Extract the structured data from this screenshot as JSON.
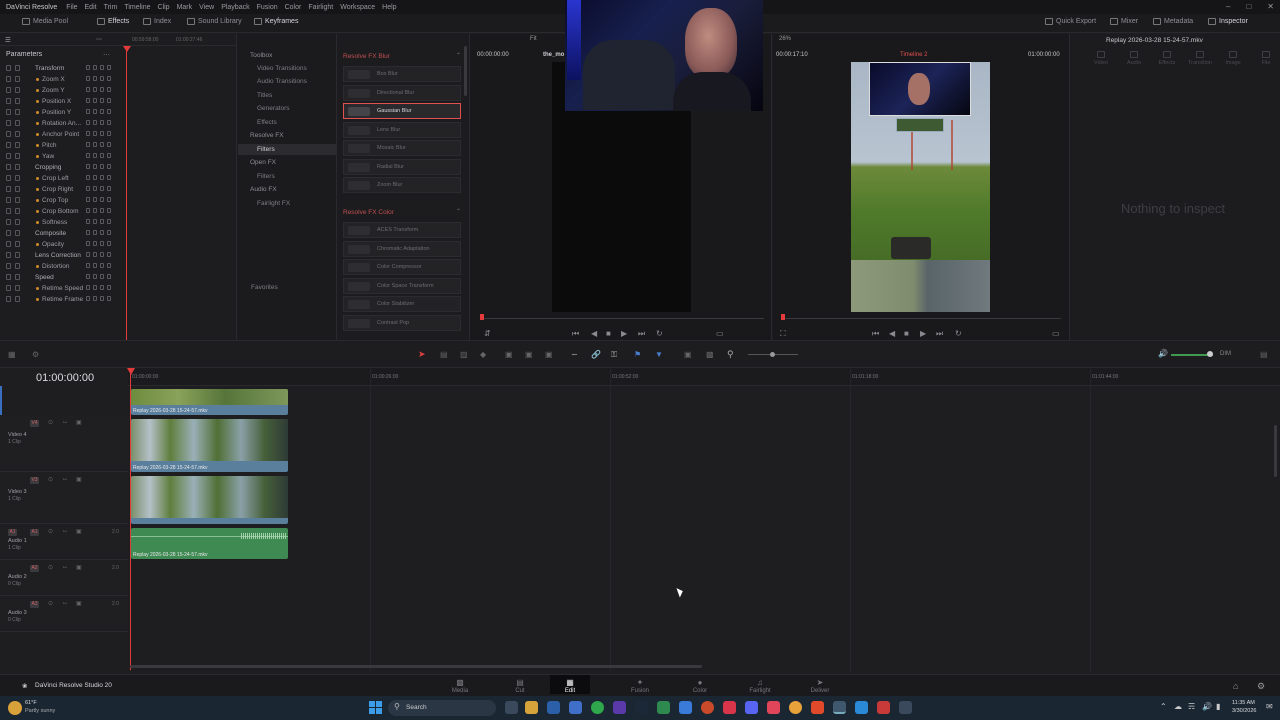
{
  "menu": {
    "app": "DaVinci Resolve",
    "items": [
      "File",
      "Edit",
      "Trim",
      "Timeline",
      "Clip",
      "Mark",
      "View",
      "Playback",
      "Fusion",
      "Color",
      "Fairlight",
      "Workspace",
      "Help"
    ]
  },
  "toolbar": {
    "media_pool": "Media Pool",
    "effects": "Effects",
    "index": "Index",
    "sound_library": "Sound Library",
    "keyframes": "Keyframes",
    "quick_export": "Quick Export",
    "mixer": "Mixer",
    "metadata": "Metadata",
    "inspector": "Inspector"
  },
  "parameters": {
    "title": "Parameters",
    "rows": [
      {
        "label": "Transform",
        "group": true
      },
      {
        "label": "Zoom X",
        "group": false
      },
      {
        "label": "Zoom Y",
        "group": false
      },
      {
        "label": "Position X",
        "group": false
      },
      {
        "label": "Position Y",
        "group": false
      },
      {
        "label": "Rotation An...",
        "group": false
      },
      {
        "label": "Anchor Point",
        "group": false
      },
      {
        "label": "Pitch",
        "group": false
      },
      {
        "label": "Yaw",
        "group": false
      },
      {
        "label": "Cropping",
        "group": true
      },
      {
        "label": "Crop Left",
        "group": false
      },
      {
        "label": "Crop Right",
        "group": false
      },
      {
        "label": "Crop Top",
        "group": false
      },
      {
        "label": "Crop Bottom",
        "group": false
      },
      {
        "label": "Softness",
        "group": false
      },
      {
        "label": "Composite",
        "group": true
      },
      {
        "label": "Opacity",
        "group": false
      },
      {
        "label": "Lens Correction",
        "group": true
      },
      {
        "label": "Distortion",
        "group": false
      },
      {
        "label": "Speed",
        "group": true
      },
      {
        "label": "Retime Speed",
        "group": false
      },
      {
        "label": "Retime Frame",
        "group": false
      }
    ],
    "ruler": [
      "00:59:58:00",
      "01:00:27:46"
    ]
  },
  "library": {
    "toolbox": "Toolbox",
    "video_transitions": "Video Transitions",
    "audio_transitions": "Audio Transitions",
    "titles": "Titles",
    "generators": "Generators",
    "effects": "Effects",
    "resolve_fx": "Resolve FX",
    "filters": "Filters",
    "open_fx": "Open FX",
    "open_filters": "Filters",
    "audio_fx": "Audio FX",
    "fairlight_fx": "Fairlight FX",
    "favorites": "Favorites"
  },
  "fx": {
    "blur_header": "Resolve FX Blur",
    "blur_items": [
      "Box Blur",
      "Directional Blur",
      "Gaussian Blur",
      "Lens Blur",
      "Mosaic Blur",
      "Radial Blur",
      "Zoom Blur"
    ],
    "selected": "Gaussian Blur",
    "color_header": "Resolve FX Color",
    "color_items": [
      "ACES Transform",
      "Chromatic Adaptation",
      "Color Compressor",
      "Color Space Transform",
      "Color Stabilizer",
      "Contrast Pop"
    ]
  },
  "source_viewer": {
    "zoom": "Fit",
    "timecode": "00:00:00:00",
    "clip_name": "the_mo"
  },
  "timeline_viewer": {
    "zoom": "26%",
    "duration": "00:00:17:10",
    "name": "Timeline 2",
    "timecode": "01:00:00:00"
  },
  "inspector": {
    "title": "Replay 2026-03-28 15-24-57.mkv",
    "tabs": [
      "Video",
      "Audio",
      "Effects",
      "Transition",
      "Image",
      "File"
    ],
    "empty": "Nothing to inspect"
  },
  "timeline": {
    "timecode": "01:00:00:00",
    "ruler": [
      "01:00:00:00",
      "01:00:26:00",
      "01:00:52:00",
      "01:01:18:00",
      "01:01:44:00"
    ],
    "tracks": [
      {
        "id": "V4",
        "name": "Video 4",
        "clips": "1 Clip"
      },
      {
        "id": "V3",
        "name": "Video 3",
        "clips": "1 Clip"
      },
      {
        "id": "A1",
        "name": "Audio 1",
        "clips": "1 Clip",
        "level": "2.0"
      },
      {
        "id": "A2",
        "name": "Audio 2",
        "clips": "0 Clip",
        "level": "2.0"
      },
      {
        "id": "A3",
        "name": "Audio 3",
        "clips": "0 Clip",
        "level": "2.0"
      }
    ],
    "clip_name": "Replay 2026-03-28 15-24-57.mkv",
    "dim": "DIM"
  },
  "pages": [
    "Media",
    "Cut",
    "Edit",
    "Fusion",
    "Color",
    "Fairlight",
    "Deliver"
  ],
  "active_page": "Edit",
  "brand": "DaVinci Resolve Studio 20",
  "taskbar": {
    "weather_temp": "61°F",
    "weather_desc": "Partly sunny",
    "search": "Search",
    "time": "11:35 AM",
    "date": "3/30/2026"
  },
  "colors": {
    "accent": "#e05050",
    "playhead": "#e33b3b",
    "video_clip": "#5a7f9c",
    "audio_clip": "#3f8a52"
  }
}
